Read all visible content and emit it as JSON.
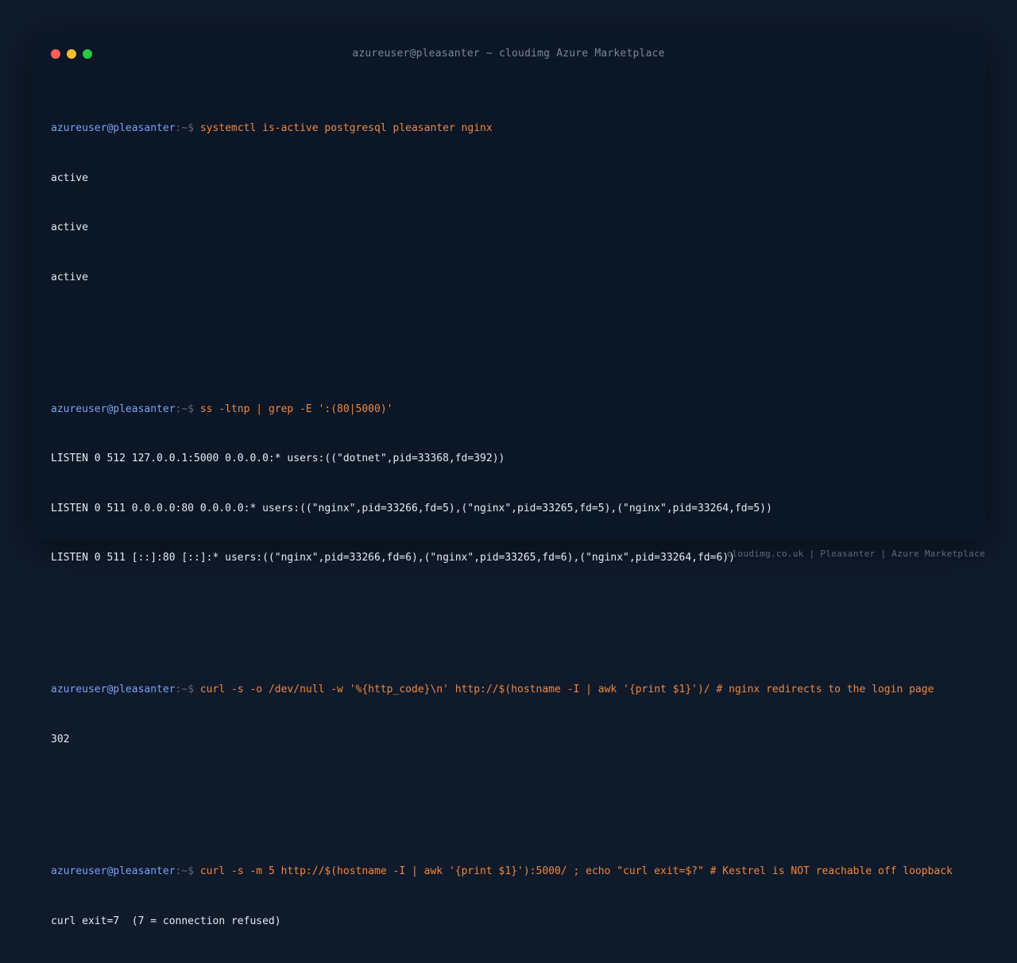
{
  "window": {
    "title": "azureuser@pleasanter ~ cloudimg Azure Marketplace"
  },
  "prompt": {
    "user_host": "azureuser@pleasanter",
    "path_symbol": ":~$ "
  },
  "blocks": [
    {
      "command": "systemctl is-active postgresql pleasanter nginx",
      "output": [
        "active",
        "active",
        "active"
      ]
    },
    {
      "command": "ss -ltnp | grep -E ':(80|5000)'",
      "output": [
        "LISTEN 0 512 127.0.0.1:5000 0.0.0.0:* users:((\"dotnet\",pid=33368,fd=392))",
        "LISTEN 0 511 0.0.0.0:80 0.0.0.0:* users:((\"nginx\",pid=33266,fd=5),(\"nginx\",pid=33265,fd=5),(\"nginx\",pid=33264,fd=5))",
        "LISTEN 0 511 [::]:80 [::]:* users:((\"nginx\",pid=33266,fd=6),(\"nginx\",pid=33265,fd=6),(\"nginx\",pid=33264,fd=6))"
      ]
    },
    {
      "command": "curl -s -o /dev/null -w '%{http_code}\\n' http://$(hostname -I | awk '{print $1}')/ # nginx redirects to the login page",
      "output": [
        "302"
      ]
    },
    {
      "command": "curl -s -m 5 http://$(hostname -I | awk '{print $1}'):5000/ ; echo \"curl exit=$?\" # Kestrel is NOT reachable off loopback",
      "output": [
        "curl exit=7  (7 = connection refused)"
      ]
    }
  ],
  "footer": {
    "text": "cloudimg.co.uk | Pleasanter | Azure Marketplace"
  },
  "colors": {
    "background": "#0f1a2b",
    "terminal_background": "#0b1626",
    "prompt_user": "#7aa2f7",
    "command": "#f0883e",
    "output": "#e6eaf0",
    "traffic_close": "#ff5f57",
    "traffic_minimize": "#febc2e",
    "traffic_zoom": "#28c840"
  }
}
